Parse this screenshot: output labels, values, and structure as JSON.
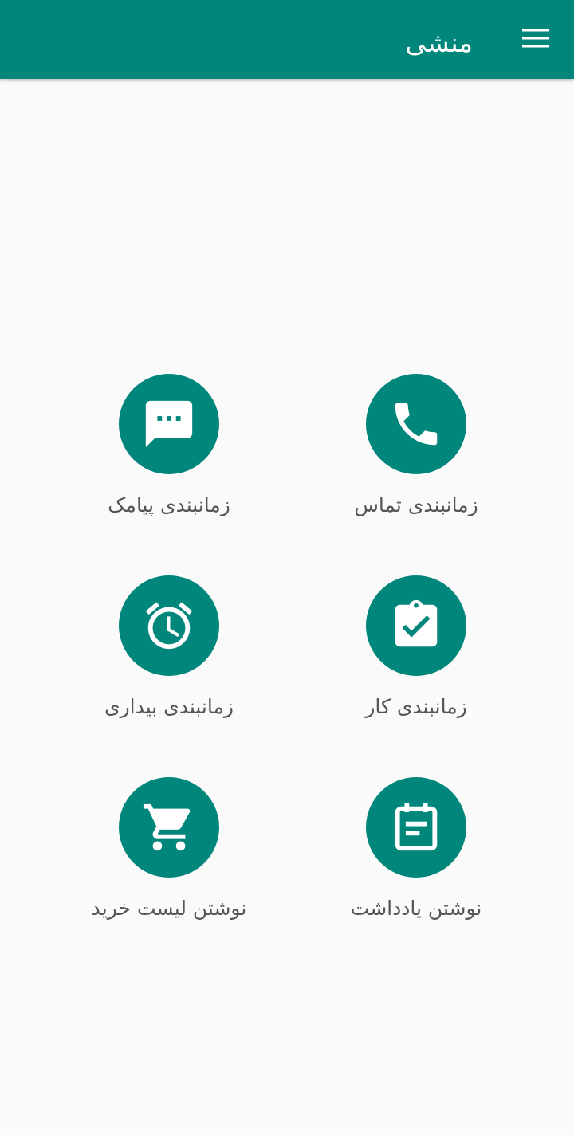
{
  "app": {
    "title": "منشی",
    "menu_icon": "hamburger-menu-icon"
  },
  "colors": {
    "primary": "#00867a",
    "background": "#fafafa",
    "label": "#555555"
  },
  "tiles": [
    {
      "label": "زمانبندی تماس",
      "icon": "phone-icon"
    },
    {
      "label": "زمانبندی پیامک",
      "icon": "sms-message-icon"
    },
    {
      "label": "زمانبندی کار",
      "icon": "clipboard-check-icon"
    },
    {
      "label": "زمانبندی بیداری",
      "icon": "alarm-clock-icon"
    },
    {
      "label": "نوشتن یادداشت",
      "icon": "notes-calendar-icon"
    },
    {
      "label": "نوشتن لیست خرید",
      "icon": "shopping-cart-icon"
    }
  ]
}
